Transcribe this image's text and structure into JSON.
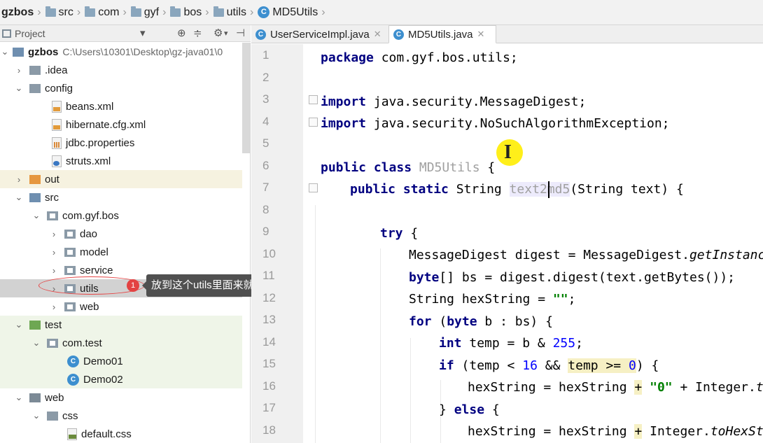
{
  "breadcrumb": [
    {
      "label": "gzbos",
      "icon": "project-icon"
    },
    {
      "label": "src",
      "icon": "folder-icon"
    },
    {
      "label": "com",
      "icon": "folder-icon"
    },
    {
      "label": "gyf",
      "icon": "folder-icon"
    },
    {
      "label": "bos",
      "icon": "folder-icon"
    },
    {
      "label": "utils",
      "icon": "folder-icon"
    },
    {
      "label": "MD5Utils",
      "icon": "class-icon"
    }
  ],
  "project_panel": {
    "title": "Project",
    "root": {
      "label": "gzbos",
      "path": "C:\\Users\\10301\\Desktop\\gz-java01\\0"
    },
    "items": [
      {
        "label": ".idea"
      },
      {
        "label": "config"
      },
      {
        "label": "beans.xml"
      },
      {
        "label": "hibernate.cfg.xml"
      },
      {
        "label": "jdbc.properties"
      },
      {
        "label": "struts.xml"
      },
      {
        "label": "out"
      },
      {
        "label": "src"
      },
      {
        "label": "com.gyf.bos"
      },
      {
        "label": "dao"
      },
      {
        "label": "model"
      },
      {
        "label": "service"
      },
      {
        "label": "utils"
      },
      {
        "label": "web"
      },
      {
        "label": "test"
      },
      {
        "label": "com.test"
      },
      {
        "label": "Demo01"
      },
      {
        "label": "Demo02"
      },
      {
        "label": "web"
      },
      {
        "label": "css"
      },
      {
        "label": "default.css"
      }
    ]
  },
  "annotation": {
    "badge": "1",
    "text": "放到这个utils里面来就行了"
  },
  "tabs": [
    {
      "label": "UserServiceImpl.java",
      "active": false
    },
    {
      "label": "MD5Utils.java",
      "active": true
    }
  ],
  "editor": {
    "line_numbers": [
      "1",
      "2",
      "3",
      "4",
      "5",
      "6",
      "7",
      "8",
      "9",
      "10",
      "11",
      "12",
      "13",
      "14",
      "15",
      "16",
      "17",
      "18"
    ],
    "code": {
      "l1_kw": "package",
      "l1_rest": " com.gyf.bos.utils;",
      "l3_kw": "import",
      "l3_rest": " java.security.MessageDigest;",
      "l4_kw": "import",
      "l4_rest": " java.security.NoSuchAlgorithmException;",
      "l6_kw": "public class",
      "l6_name": " MD5Utils",
      "l6_rest": " {",
      "l7_kw": "public static",
      "l7_type": " String ",
      "l7_m1": "text2",
      "l7_m2": "md5",
      "l7_rest": "(String text) {",
      "l9_kw": "try",
      "l9_rest": " {",
      "l10_a": "MessageDigest digest = MessageDigest.",
      "l10_b": "getInstance",
      "l11_kw": "byte",
      "l11_rest": "[] bs = digest.digest(text.getBytes());",
      "l12_a": "String hexString = ",
      "l12_str": "\"\"",
      "l12_b": ";",
      "l13_kw1": "for",
      "l13_a": " (",
      "l13_kw2": "byte",
      "l13_b": " b : bs) {",
      "l14_kw": "int",
      "l14_a": " temp = b & ",
      "l14_num": "255",
      "l14_b": ";",
      "l15_kw": "if",
      "l15_a": " (temp < ",
      "l15_num1": "16",
      "l15_b": " && ",
      "l15_hl": "temp >= ",
      "l15_num2": "0",
      "l15_c": ") {",
      "l16_a": "hexString = hexString ",
      "l16_plus": "+",
      "l16_sp": " ",
      "l16_str": "\"0\"",
      "l16_b": " + Integer.",
      "l16_i": "to",
      "l17_a": "} ",
      "l17_kw": "else",
      "l17_b": " {",
      "l18_a": "hexString = hexString ",
      "l18_plus": "+",
      "l18_b": " Integer.",
      "l18_i": "toHexStr"
    }
  },
  "colors": {
    "keyword": "#000080",
    "string": "#008000",
    "number": "#0000ff",
    "current_line": "#fefbe0",
    "annotation_red": "#e34242"
  }
}
